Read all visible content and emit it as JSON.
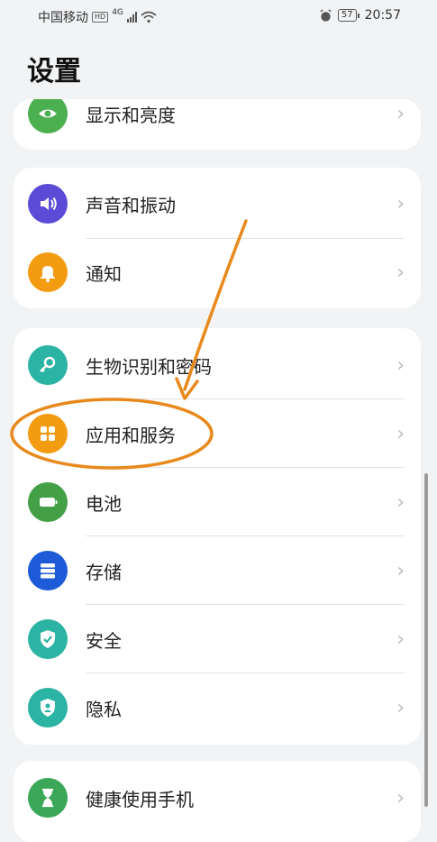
{
  "status_bar": {
    "carrier": "中国移动",
    "hd": "HD",
    "net": "4G",
    "battery": "57",
    "time": "20:57"
  },
  "page_title": "设置",
  "groups": [
    {
      "items": [
        {
          "label": "显示和亮度",
          "icon": "eye-icon",
          "color": "#4caf50"
        }
      ]
    },
    {
      "items": [
        {
          "label": "声音和振动",
          "icon": "speaker-icon",
          "color": "#5b4bd6"
        },
        {
          "label": "通知",
          "icon": "bell-icon",
          "color": "#f39c12"
        }
      ]
    },
    {
      "items": [
        {
          "label": "生物识别和密码",
          "icon": "key-icon",
          "color": "#2bb3a3"
        },
        {
          "label": "应用和服务",
          "icon": "apps-icon",
          "color": "#f39c12"
        },
        {
          "label": "电池",
          "icon": "battery-icon",
          "color": "#43a047"
        },
        {
          "label": "存储",
          "icon": "storage-icon",
          "color": "#1e5bd8"
        },
        {
          "label": "安全",
          "icon": "shield-check-icon",
          "color": "#2bb3a3"
        },
        {
          "label": "隐私",
          "icon": "privacy-shield-icon",
          "color": "#2bb3a3"
        }
      ]
    },
    {
      "items": [
        {
          "label": "健康使用手机",
          "icon": "hourglass-icon",
          "color": "#3aa858"
        }
      ]
    }
  ],
  "chevron": "›",
  "annotation": {
    "color": "#e8891c"
  }
}
